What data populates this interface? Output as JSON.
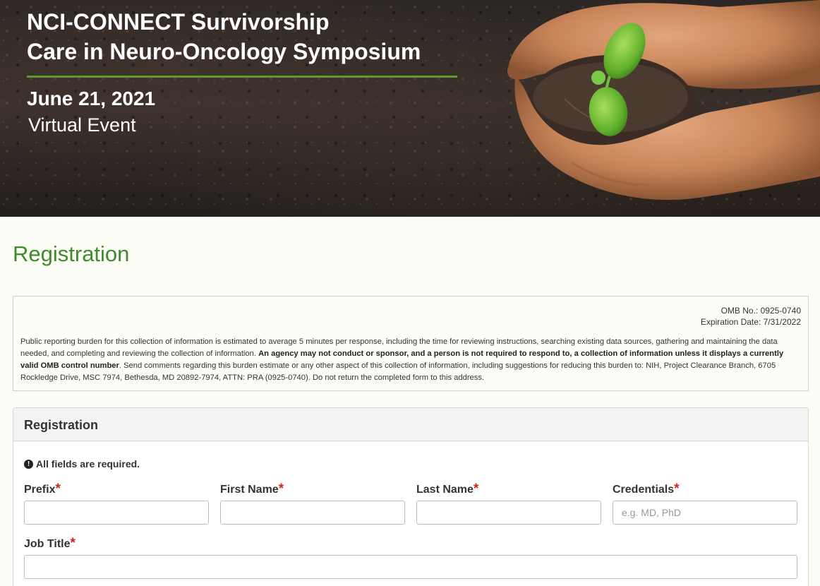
{
  "hero": {
    "title_line1": "NCI-CONNECT Survivorship",
    "title_line2": "Care in Neuro-Oncology Symposium",
    "date": "June 21, 2021",
    "subtitle": "Virtual Event",
    "accent_color": "#5e9b2f"
  },
  "page": {
    "title": "Registration",
    "title_color": "#3d8b2a"
  },
  "notice": {
    "omb_no": "OMB No.: 0925-0740",
    "expiration": "Expiration Date: 7/31/2022",
    "burden_part1": "Public reporting burden for this collection of information is estimated to average 5 minutes per response, including the time for reviewing instructions, searching existing data sources, gathering and maintaining the data needed, and completing and reviewing the collection of information. ",
    "burden_bold": "An agency may not conduct or sponsor, and a person is not required to respond to, a collection of information unless it displays a currently valid OMB control number",
    "burden_part2": ". Send comments regarding this burden estimate or any other aspect of this collection of information, including suggestions for reducing this burden to: NIH, Project Clearance Branch, 6705 Rockledge Drive, MSC 7974, Bethesda, MD 20892-7974, ATTN: PRA (0925-0740). Do not return the completed form to this address."
  },
  "form": {
    "panel_title": "Registration",
    "required_note": "All fields are required.",
    "required_marker": "*",
    "fields": {
      "prefix": {
        "label": "Prefix",
        "value": "",
        "placeholder": ""
      },
      "first_name": {
        "label": "First Name",
        "value": "",
        "placeholder": ""
      },
      "last_name": {
        "label": "Last Name",
        "value": "",
        "placeholder": ""
      },
      "credentials": {
        "label": "Credentials",
        "value": "",
        "placeholder": "e.g. MD, PhD"
      },
      "job_title": {
        "label": "Job Title",
        "value": "",
        "placeholder": ""
      }
    }
  }
}
